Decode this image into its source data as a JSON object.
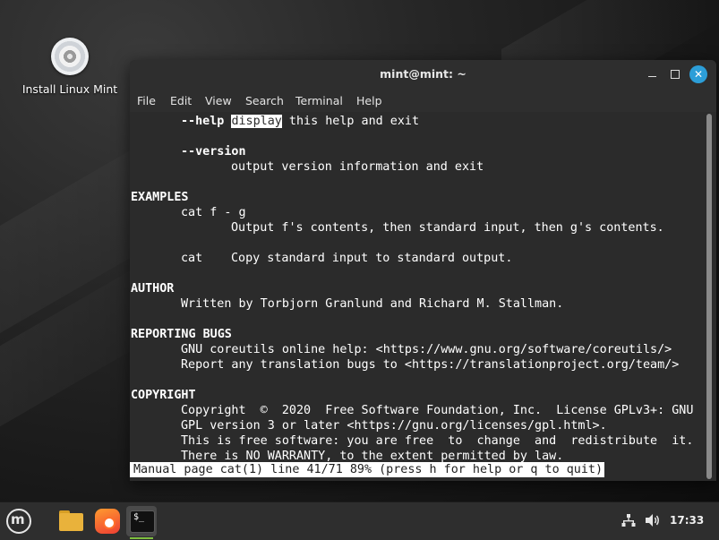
{
  "desktop": {
    "icon_label": "Install Linux Mint",
    "icon_name": "optical-disc-icon"
  },
  "window": {
    "title": "mint@mint: ~",
    "buttons": [
      "minimize",
      "maximize",
      "close"
    ],
    "close_color": "#2c9ed8",
    "menu": [
      "File",
      "Edit",
      "View",
      "Search",
      "Terminal",
      "Help"
    ]
  },
  "terminal": {
    "help_option": "--help",
    "help_highlight": "display",
    "help_rest": " this help and exit",
    "version_option": "--version",
    "version_desc": "output version information and exit",
    "examples_heading": "EXAMPLES",
    "example1_cmd": "cat f - g",
    "example1_desc": "Output f's contents, then standard input, then g's contents.",
    "example2_cmd": "cat",
    "example2_desc": "Copy standard input to standard output.",
    "author_heading": "AUTHOR",
    "author_text": "Written by Torbjorn Granlund and Richard M. Stallman.",
    "bugs_heading": "REPORTING BUGS",
    "bugs_line1": "GNU coreutils online help: <https://www.gnu.org/software/coreutils/>",
    "bugs_line2": "Report any translation bugs to <https://translationproject.org/team/>",
    "copyright_heading": "COPYRIGHT",
    "copyright_line1": "Copyright  ©  2020  Free Software Foundation, Inc.  License GPLv3+: GNU",
    "copyright_line2": "GPL version 3 or later <https://gnu.org/licenses/gpl.html>.",
    "copyright_line3": "This is free software: you are free  to  change  and  redistribute  it.",
    "copyright_line4": "There is NO WARRANTY, to the extent permitted by law.",
    "status": "Manual page cat(1) line 41/71 89% (press h for help or q to quit)",
    "background": "#2b2b2b",
    "foreground": "#ffffff"
  },
  "taskbar": {
    "launchers": [
      "mint-menu-icon",
      "folder-icon",
      "firefox-icon",
      "terminal-icon"
    ],
    "terminal_glyph": "$_",
    "menu_glyph": "m",
    "clock": "17:33",
    "tray": [
      "network-icon",
      "volume-icon"
    ],
    "active_indicator_color": "#7fbf3f"
  }
}
